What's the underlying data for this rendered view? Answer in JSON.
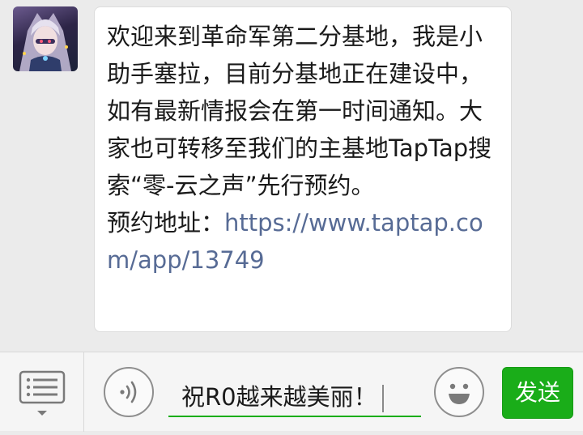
{
  "message": {
    "lines": [
      "欢迎来到革命军第二分基地，我是小助手塞拉，目前分基地正在建设中，如有最新情报会在第一时间通知。大家也可转移至我们的主基地TapTap搜索“零-云之声”先行预约。"
    ],
    "address_label": "预约地址：",
    "address_link": "https://www.taptap.com/app/13749"
  },
  "input": {
    "value": "祝R0越来越美丽！"
  },
  "send_button": {
    "label": "发送"
  },
  "colors": {
    "send_green": "#1aad19",
    "link": "#576b95",
    "chat_bg": "#ebebeb"
  },
  "icons": {
    "menu": "list-menu-icon",
    "voice": "voice-icon",
    "emoji": "smiley-icon"
  }
}
